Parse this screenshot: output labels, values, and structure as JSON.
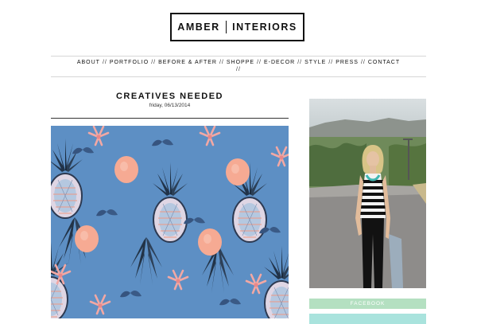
{
  "logo": {
    "left": "AMBER",
    "right": "INTERIORS"
  },
  "nav": {
    "items": [
      "ABOUT",
      "PORTFOLIO",
      "BEFORE & AFTER",
      "SHOPPE",
      "E-DECOR",
      "STYLE",
      "PRESS",
      "CONTACT"
    ],
    "separator": "//"
  },
  "post": {
    "title": "CREATIVES NEEDED",
    "date": "friday, 06/13/2014"
  },
  "sidebar": {
    "social": [
      {
        "label": "FACEBOOK",
        "color": "#b4e0c1"
      },
      {
        "label": "",
        "color": "#a9e3dd"
      }
    ]
  },
  "colors": {
    "pattern_bg": "#5d8fc4",
    "accent_pink": "#f2a590",
    "rule": "#333333"
  }
}
